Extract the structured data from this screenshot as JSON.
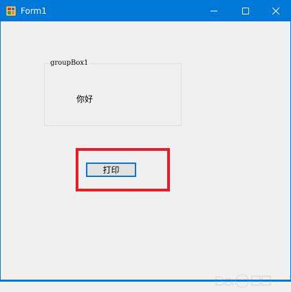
{
  "window": {
    "title": "Form1"
  },
  "titlebar_controls": {
    "minimize": "minimize-icon",
    "maximize": "maximize-icon",
    "close": "close-icon"
  },
  "groupbox": {
    "title": "groupBox1",
    "label_text": "你好"
  },
  "button": {
    "label": "打印"
  },
  "colors": {
    "titlebar": "#0078d7",
    "highlight": "#e81c24",
    "background": "#f0f0f0"
  }
}
